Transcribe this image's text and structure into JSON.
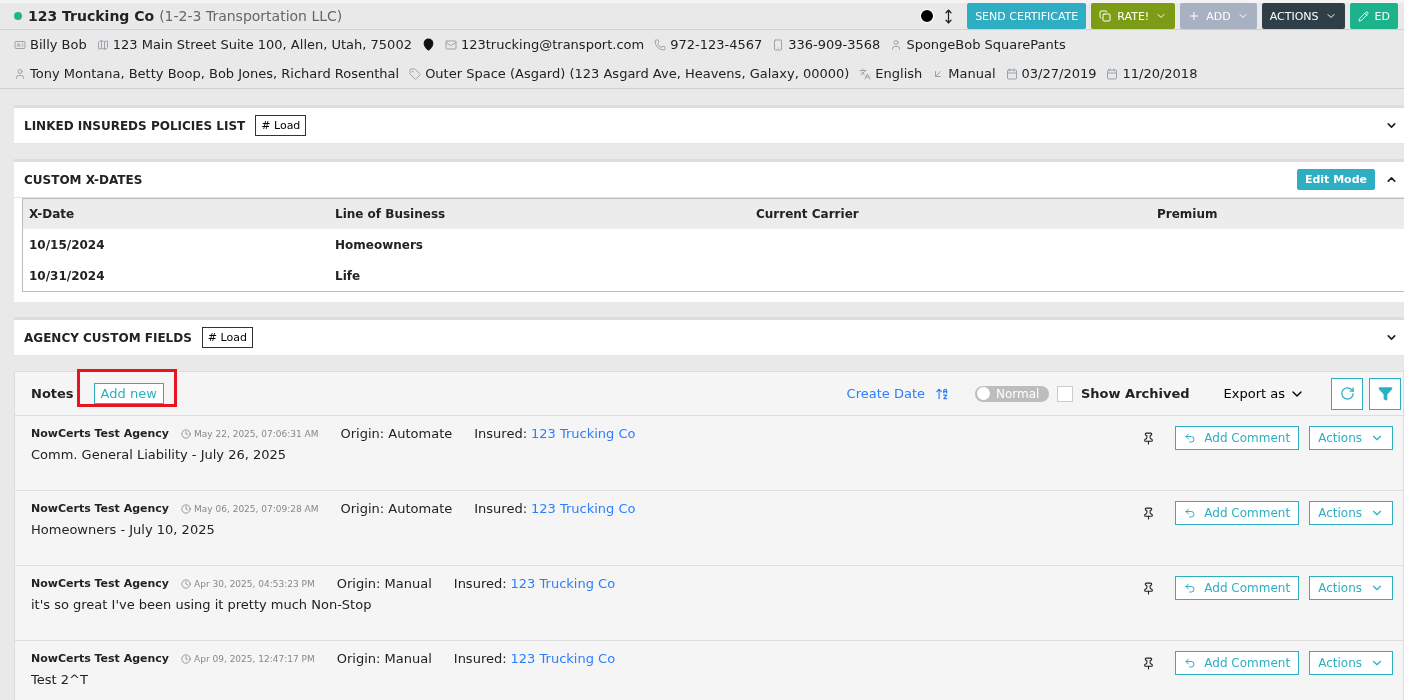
{
  "header": {
    "online": true,
    "title": "123 Trucking Co",
    "subtitle": "(1-2-3 Transportation LLC)",
    "buttons": [
      {
        "kind": "teal",
        "label": "SEND CERTIFICATE"
      },
      {
        "kind": "rate",
        "label": "RATE!"
      },
      {
        "kind": "add",
        "label": "ADD"
      },
      {
        "kind": "actions",
        "label": "ACTIONS"
      },
      {
        "kind": "edit",
        "label": "ED"
      }
    ]
  },
  "info_rows": [
    [
      {
        "kind": "card",
        "text": "Billy Bob"
      },
      {
        "kind": "map",
        "text": "123 Main Street Suite 100, Allen, Utah, 75002"
      },
      {
        "kind": "pin",
        "text": ""
      },
      {
        "kind": "mail",
        "text": "123trucking@transport.com"
      },
      {
        "kind": "phone",
        "text": "972-123-4567"
      },
      {
        "kind": "mobile",
        "text": "336-909-3568"
      },
      {
        "kind": "user",
        "text": "SpongeBob SquarePants"
      }
    ],
    [
      {
        "kind": "user",
        "text": "Tony Montana, Betty Boop, Bob Jones, Richard Rosenthal"
      },
      {
        "kind": "tag",
        "text": "Outer Space (Asgard) (123 Asgard Ave, Heavens, Galaxy, 00000)"
      },
      {
        "kind": "lang",
        "text": "English"
      },
      {
        "kind": "source",
        "text": "Manual"
      },
      {
        "kind": "calendar",
        "text": "03/27/2019"
      },
      {
        "kind": "calendar",
        "text": "11/20/2018"
      }
    ]
  ],
  "sections": [
    {
      "kind": "load",
      "title": "LINKED INSUREDS POLICIES LIST",
      "load_label": "# Load",
      "expanded": false
    },
    {
      "kind": "table",
      "title": "CUSTOM X-DATES",
      "action_label": "Edit Mode",
      "expanded": true,
      "columns": [
        "X-Date",
        "Line of Business",
        "Current Carrier",
        "Premium"
      ],
      "rows": [
        [
          "10/15/2024",
          "Homeowners"
        ],
        [
          "10/31/2024",
          "Life"
        ]
      ]
    },
    {
      "kind": "load",
      "title": "AGENCY CUSTOM FIELDS",
      "load_label": "# Load",
      "expanded": false
    }
  ],
  "notes": {
    "title": "Notes",
    "add_label": "Add new",
    "sort_label": "Create Date",
    "toggle": {
      "label": "Normal",
      "on": false
    },
    "show_archived": {
      "label": "Show Archived",
      "checked": false
    },
    "export_label": "Export as",
    "items": [
      {
        "author": "NowCerts Test Agency",
        "time": "May 22, 2025, 07:06:31 AM",
        "origin": "Origin: Automate",
        "insured_label": "Insured:",
        "insured": "123 Trucking Co",
        "body": "Comm. General Liability - July 26, 2025",
        "comment_label": "Add Comment",
        "actions_label": "Actions"
      },
      {
        "author": "NowCerts Test Agency",
        "time": "May 06, 2025, 07:09:28 AM",
        "origin": "Origin: Automate",
        "insured_label": "Insured:",
        "insured": "123 Trucking Co",
        "body": "Homeowners - July 10, 2025",
        "comment_label": "Add Comment",
        "actions_label": "Actions"
      },
      {
        "author": "NowCerts Test Agency",
        "time": "Apr 30, 2025, 04:53:23 PM",
        "origin": "Origin: Manual",
        "insured_label": "Insured:",
        "insured": "123 Trucking Co",
        "body": "it's so great I've been using it pretty much Non-Stop",
        "comment_label": "Add Comment",
        "actions_label": "Actions"
      },
      {
        "author": "NowCerts Test Agency",
        "time": "Apr 09, 2025, 12:47:17 PM",
        "origin": "Origin: Manual",
        "insured_label": "Insured:",
        "insured": "123 Trucking Co",
        "body": "Test 2^T",
        "comment_label": "Add Comment",
        "actions_label": "Actions"
      }
    ]
  }
}
